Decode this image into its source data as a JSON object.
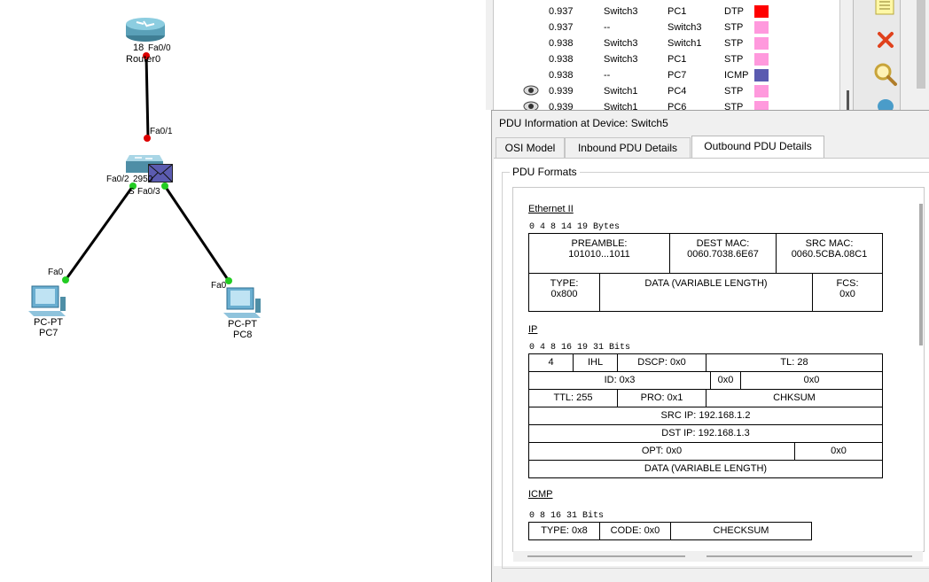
{
  "topology": {
    "router": {
      "name": "Router0",
      "type_partial": "18",
      "port_top": "Fa0/0"
    },
    "switch": {
      "name_partial": "S",
      "name_partial2": "2950",
      "port_up": "Fa0/1",
      "port_left": "Fa0/2",
      "port_right": "Fa0/3"
    },
    "pc7": {
      "type": "PC-PT",
      "name": "PC7",
      "port": "Fa0"
    },
    "pc8": {
      "type": "PC-PT",
      "name": "PC8",
      "port": "Fa0"
    },
    "colors": {
      "link": "#000000",
      "port_up": "#22cc22",
      "port_down": "#dd0000"
    }
  },
  "events": [
    {
      "time": "0.937",
      "last": "Switch3",
      "at": "PC1",
      "type": "DTP",
      "color": "#ff0000",
      "eye": false
    },
    {
      "time": "0.937",
      "last": "--",
      "at": "Switch3",
      "type": "STP",
      "color": "#ff99dd",
      "eye": false
    },
    {
      "time": "0.938",
      "last": "Switch3",
      "at": "Switch1",
      "type": "STP",
      "color": "#ff99dd",
      "eye": false
    },
    {
      "time": "0.938",
      "last": "Switch3",
      "at": "PC1",
      "type": "STP",
      "color": "#ff99dd",
      "eye": false
    },
    {
      "time": "0.938",
      "last": "--",
      "at": "PC7",
      "type": "ICMP",
      "color": "#5b5bb0",
      "eye": false
    },
    {
      "time": "0.939",
      "last": "Switch1",
      "at": "PC4",
      "type": "STP",
      "color": "#ff99dd",
      "eye": true
    },
    {
      "time": "0.939",
      "last": "Switch1",
      "at": "PC6",
      "type": "STP",
      "color": "#ff99dd",
      "eye": true
    }
  ],
  "dialog": {
    "title": "PDU Information at Device: Switch5",
    "tabs": [
      "OSI Model",
      "Inbound PDU Details",
      "Outbound PDU Details"
    ],
    "active_tab": "Outbound PDU Details",
    "group_label": "PDU Formats"
  },
  "ethernet": {
    "title": "Ethernet II",
    "ruler": "0           4            8                    14                 19  Bytes",
    "preamble_label": "PREAMBLE:",
    "preamble_value": "101010...1011",
    "dest_label": "DEST MAC:",
    "dest_value": "0060.7038.6E67",
    "src_label": "SRC MAC:",
    "src_value": "0060.5CBA.08C1",
    "type_label": "TYPE:",
    "type_value": "0x800",
    "data": "DATA (VARIABLE LENGTH)",
    "fcs_label": "FCS:",
    "fcs_value": "0x0"
  },
  "ip": {
    "title": "IP",
    "ruler": "0       4       8                 16  19                          31  Bits",
    "version": "4",
    "ihl": "IHL",
    "dscp": "DSCP: 0x0",
    "tl": "TL: 28",
    "id": "ID: 0x3",
    "flags": "0x0",
    "frag": "0x0",
    "ttl": "TTL: 255",
    "pro": "PRO: 0x1",
    "chksum": "CHKSUM",
    "src_ip": "SRC IP: 192.168.1.2",
    "dst_ip": "DST IP: 192.168.1.3",
    "opt": "OPT: 0x0",
    "opt_pad": "0x0",
    "data": "DATA (VARIABLE LENGTH)"
  },
  "icmp": {
    "title": "ICMP",
    "ruler": "0             8              16                          31  Bits",
    "type": "TYPE: 0x8",
    "code": "CODE: 0x0",
    "checksum": "CHECKSUM"
  }
}
